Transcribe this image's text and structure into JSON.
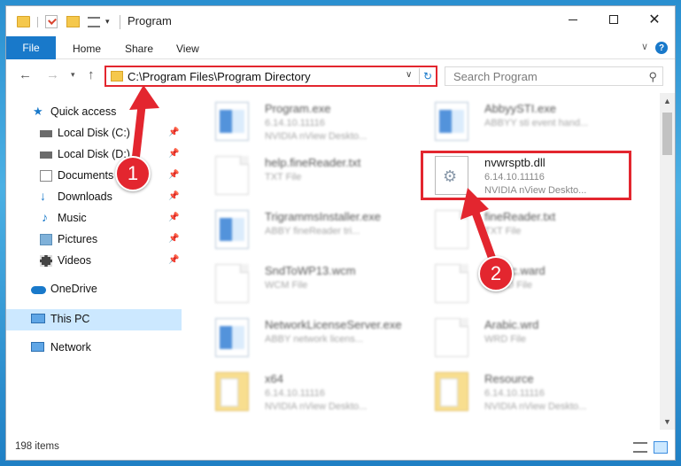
{
  "window": {
    "title": "Program",
    "quick_access_dropdown": "▾"
  },
  "ribbon": {
    "tabs": [
      "File",
      "Home",
      "Share",
      "View"
    ]
  },
  "address_bar": {
    "path": "C:\\Program Files\\Program Directory",
    "search_placeholder": "Search Program"
  },
  "sidebar": {
    "items": [
      {
        "label": "Quick access",
        "icon": "star-icon"
      },
      {
        "label": "Local Disk (C:)",
        "icon": "drive-icon",
        "pinned": true
      },
      {
        "label": "Local Disk (D:)",
        "icon": "drive-icon",
        "pinned": true
      },
      {
        "label": "Documents",
        "icon": "documents-icon",
        "pinned": true
      },
      {
        "label": "Downloads",
        "icon": "download-icon",
        "pinned": true
      },
      {
        "label": "Music",
        "icon": "music-icon",
        "pinned": true
      },
      {
        "label": "Pictures",
        "icon": "pictures-icon",
        "pinned": true
      },
      {
        "label": "Videos",
        "icon": "videos-icon",
        "pinned": true
      },
      {
        "label": "OneDrive",
        "icon": "cloud-icon"
      },
      {
        "label": "This PC",
        "icon": "computer-icon",
        "selected": true
      },
      {
        "label": "Network",
        "icon": "network-icon"
      }
    ]
  },
  "files": [
    {
      "name": "Program.exe",
      "line1": "6.14.10.11116",
      "line2": "NVIDIA nView Deskto...",
      "icon": "exe-icon"
    },
    {
      "name": "AbbyySTI.exe",
      "line1": "ABBYY sti event hand...",
      "line2": "",
      "icon": "exe-icon"
    },
    {
      "name": "help.fineReader.txt",
      "line1": "TXT File",
      "line2": "",
      "icon": "document-icon"
    },
    {
      "name": "nvwrsptb.dll",
      "line1": "6.14.10.11116",
      "line2": "NVIDIA nView Deskto...",
      "icon": "dll-gear-icon"
    },
    {
      "name": "TrigrammsInstaller.exe",
      "line1": "ABBY fineReader tri...",
      "line2": "",
      "icon": "exe-icon"
    },
    {
      "name": "fineReader.txt",
      "line1": "TXT File",
      "line2": "",
      "icon": "document-icon"
    },
    {
      "name": "SndToWP13.wcm",
      "line1": "WCM File",
      "line2": "",
      "icon": "document-icon"
    },
    {
      "name": "Arabic.ward",
      "line1": "WARD File",
      "line2": "",
      "icon": "document-icon"
    },
    {
      "name": "NetworkLicenseServer.exe",
      "line1": "ABBY network licens...",
      "line2": "",
      "icon": "exe-icon"
    },
    {
      "name": "Arabic.wrd",
      "line1": "WRD File",
      "line2": "",
      "icon": "document-icon"
    },
    {
      "name": "x64",
      "line1": "6.14.10.11116",
      "line2": "NVIDIA nView Deskto...",
      "icon": "folder-icon"
    },
    {
      "name": "Resource",
      "line1": "6.14.10.11116",
      "line2": "NVIDIA nView Deskto...",
      "icon": "folder-icon"
    }
  ],
  "status": {
    "item_count": "198 items"
  },
  "annotations": {
    "marker1": "1",
    "marker2": "2",
    "accent_color": "#e3262f"
  }
}
